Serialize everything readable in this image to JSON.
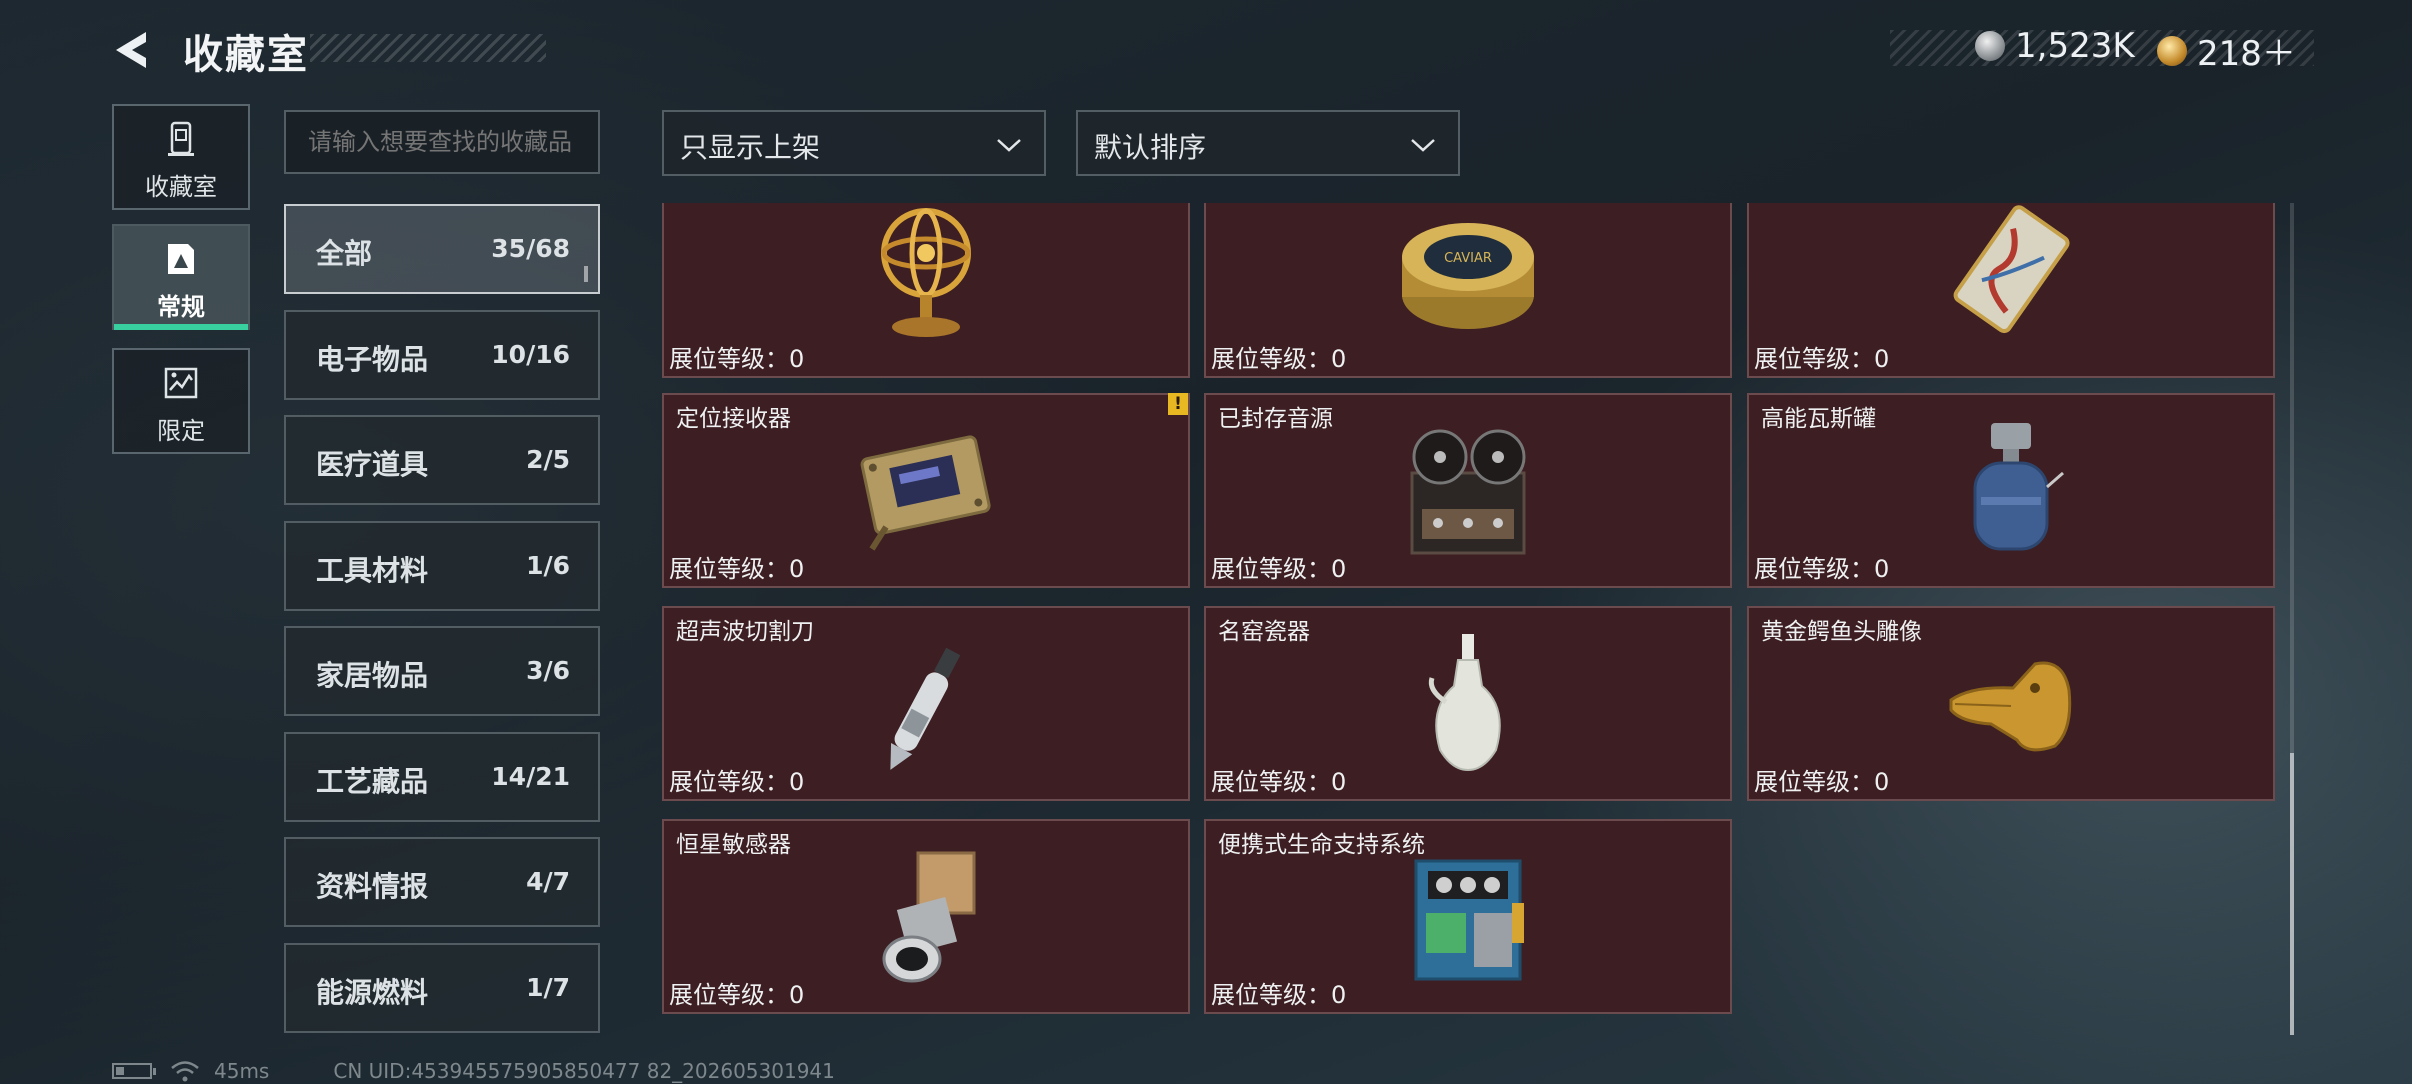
{
  "header": {
    "title": "收藏室",
    "currency_silver": "1,523K",
    "currency_gold": "218＋"
  },
  "nav": [
    {
      "label": "收藏室",
      "icon": "collection-room-icon"
    },
    {
      "label": "常规",
      "icon": "regular-icon",
      "active": true
    },
    {
      "label": "限定",
      "icon": "limited-icon"
    }
  ],
  "search": {
    "placeholder": "请输入想要查找的收藏品"
  },
  "filters": {
    "listing": "只显示上架",
    "sort": "默认排序"
  },
  "categories": [
    {
      "label": "全部",
      "count": "35/68",
      "active": true
    },
    {
      "label": "电子物品",
      "count": "10/16"
    },
    {
      "label": "医疗道具",
      "count": "2/5"
    },
    {
      "label": "工具材料",
      "count": "1/6"
    },
    {
      "label": "家居物品",
      "count": "3/6"
    },
    {
      "label": "工艺藏品",
      "count": "14/21"
    },
    {
      "label": "资料情报",
      "count": "4/7"
    },
    {
      "label": "能源燃料",
      "count": "1/7"
    }
  ],
  "items": [
    {
      "name": "",
      "level": "展位等级：0",
      "icon": "armillary-sphere-icon"
    },
    {
      "name": "",
      "level": "展位等级：0",
      "icon": "caviar-tin-icon"
    },
    {
      "name": "",
      "level": "展位等级：0",
      "icon": "ornate-card-icon"
    },
    {
      "name": "定位接收器",
      "level": "展位等级：0",
      "icon": "receiver-device-icon",
      "warning": "!"
    },
    {
      "name": "已封存音源",
      "level": "展位等级：0",
      "icon": "reel-tape-recorder-icon"
    },
    {
      "name": "高能瓦斯罐",
      "level": "展位等级：0",
      "icon": "gas-canister-icon"
    },
    {
      "name": "超声波切割刀",
      "level": "展位等级：0",
      "icon": "ultrasonic-knife-icon"
    },
    {
      "name": "名窑瓷器",
      "level": "展位等级：0",
      "icon": "porcelain-vase-icon"
    },
    {
      "name": "黄金鳄鱼头雕像",
      "level": "展位等级：0",
      "icon": "golden-crocodile-icon"
    },
    {
      "name": "恒星敏感器",
      "level": "展位等级：0",
      "icon": "star-sensor-icon"
    },
    {
      "name": "便携式生命支持系统",
      "level": "展位等级：0",
      "icon": "life-support-system-icon"
    }
  ],
  "status": {
    "ping": "45ms",
    "uid": "CN UID:453945575905850477 82_202605301941"
  }
}
